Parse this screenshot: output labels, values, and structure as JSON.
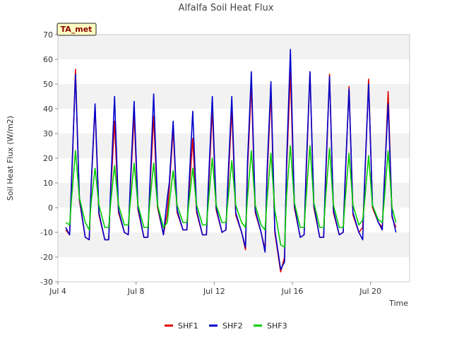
{
  "chart_data": {
    "type": "line",
    "title": "Alfalfa Soil Heat Flux",
    "xlabel": "Time",
    "ylabel": "Soil Heat Flux (W/m2)",
    "badge": "TA_met",
    "x_start_label": "Jul 4",
    "xlim": [
      "Jul 4",
      "Jul 22"
    ],
    "ylim": [
      -30,
      70
    ],
    "x_ticks": [
      "Jul 4",
      "Jul 8",
      "Jul 12",
      "Jul 16",
      "Jul 20"
    ],
    "y_ticks": [
      -30,
      -20,
      -10,
      0,
      10,
      20,
      30,
      40,
      50,
      60,
      70
    ],
    "grid": "horizontal bands",
    "legend_position": "bottom",
    "x": [
      "Jul 4.4",
      "Jul 4.6",
      "Jul 4.7",
      "Jul 4.9",
      "Jul 5.1",
      "Jul 5.4",
      "Jul 5.6",
      "Jul 5.7",
      "Jul 5.9",
      "Jul 6.1",
      "Jul 6.4",
      "Jul 6.6",
      "Jul 6.7",
      "Jul 6.9",
      "Jul 7.1",
      "Jul 7.4",
      "Jul 7.6",
      "Jul 7.7",
      "Jul 7.9",
      "Jul 8.1",
      "Jul 8.4",
      "Jul 8.6",
      "Jul 8.7",
      "Jul 8.9",
      "Jul 9.1",
      "Jul 9.4",
      "Jul 9.6",
      "Jul 9.7",
      "Jul 9.9",
      "Jul 10.1",
      "Jul 10.4",
      "Jul 10.6",
      "Jul 10.7",
      "Jul 10.9",
      "Jul 11.1",
      "Jul 11.4",
      "Jul 11.6",
      "Jul 11.7",
      "Jul 11.9",
      "Jul 12.1",
      "Jul 12.4",
      "Jul 12.6",
      "Jul 12.7",
      "Jul 12.9",
      "Jul 13.1",
      "Jul 13.4",
      "Jul 13.6",
      "Jul 13.7",
      "Jul 13.9",
      "Jul 14.1",
      "Jul 14.4",
      "Jul 14.6",
      "Jul 14.7",
      "Jul 14.9",
      "Jul 15.1",
      "Jul 15.4",
      "Jul 15.6",
      "Jul 15.7",
      "Jul 15.9",
      "Jul 16.1",
      "Jul 16.4",
      "Jul 16.6",
      "Jul 16.7",
      "Jul 16.9",
      "Jul 17.1",
      "Jul 17.4",
      "Jul 17.6",
      "Jul 17.7",
      "Jul 17.9",
      "Jul 18.1",
      "Jul 18.4",
      "Jul 18.6",
      "Jul 18.7",
      "Jul 18.9",
      "Jul 19.1",
      "Jul 19.4",
      "Jul 19.6",
      "Jul 19.7",
      "Jul 19.9",
      "Jul 20.1",
      "Jul 20.4",
      "Jul 20.6",
      "Jul 20.7",
      "Jul 20.9",
      "Jul 21.1",
      "Jul 21.3"
    ],
    "series": [
      {
        "name": "SHF1",
        "color": "#dd0000",
        "values": [
          -9,
          -11,
          10,
          56,
          3,
          -12,
          -13,
          8,
          41,
          -3,
          -13,
          -13,
          6,
          35,
          -2,
          -10,
          -11,
          7,
          38,
          -1,
          -12,
          -12,
          6,
          37,
          0,
          -11,
          -2,
          8,
          32,
          -2,
          -9,
          -9,
          5,
          28,
          -2,
          -11,
          -11,
          6,
          40,
          -1,
          -10,
          -9,
          8,
          40,
          -3,
          -10,
          -17,
          15,
          50,
          -2,
          -10,
          -17,
          11,
          47,
          -10,
          -26,
          -20,
          15,
          55,
          0,
          -12,
          -11,
          12,
          55,
          0,
          -12,
          -12,
          10,
          54,
          -2,
          -11,
          -10,
          10,
          49,
          -3,
          -10,
          -8,
          10,
          52,
          0,
          -6,
          -8,
          8,
          47,
          -4,
          -8
        ]
      },
      {
        "name": "SHF2",
        "color": "#0000cc",
        "values": [
          -8,
          -11,
          12,
          54,
          4,
          -12,
          -13,
          9,
          42,
          -2,
          -13,
          -13,
          8,
          45,
          -1,
          -10,
          -11,
          9,
          43,
          0,
          -12,
          -12,
          8,
          46,
          1,
          -11,
          4,
          10,
          35,
          -1,
          -9,
          -9,
          8,
          39,
          -1,
          -11,
          -11,
          9,
          45,
          0,
          -10,
          -9,
          11,
          45,
          -2,
          -10,
          -16,
          18,
          55,
          -1,
          -10,
          -18,
          14,
          51,
          -9,
          -25,
          -22,
          18,
          64,
          1,
          -12,
          -11,
          15,
          55,
          1,
          -12,
          -12,
          13,
          53,
          -1,
          -11,
          -10,
          12,
          48,
          -2,
          -10,
          -13,
          12,
          50,
          1,
          -6,
          -9,
          10,
          42,
          -3,
          -10
        ]
      },
      {
        "name": "SHF3",
        "color": "#00cc00",
        "values": [
          -6,
          -7,
          4,
          23,
          4,
          -6,
          -9,
          2,
          16,
          1,
          -8,
          -8,
          2,
          17,
          1,
          -7,
          -7,
          2,
          18,
          1,
          -8,
          -8,
          2,
          18,
          1,
          -8,
          -6,
          2,
          15,
          1,
          -6,
          -6,
          2,
          16,
          1,
          -7,
          -7,
          2,
          20,
          1,
          -6,
          -6,
          3,
          19,
          1,
          -6,
          -8,
          4,
          23,
          1,
          -7,
          -9,
          3,
          22,
          -1,
          -15,
          -16,
          5,
          25,
          2,
          -8,
          -8,
          4,
          25,
          2,
          -8,
          -8,
          4,
          24,
          1,
          -8,
          -8,
          3,
          22,
          1,
          -7,
          -5,
          3,
          21,
          1,
          -5,
          -6,
          3,
          23,
          0,
          -6
        ]
      }
    ]
  }
}
